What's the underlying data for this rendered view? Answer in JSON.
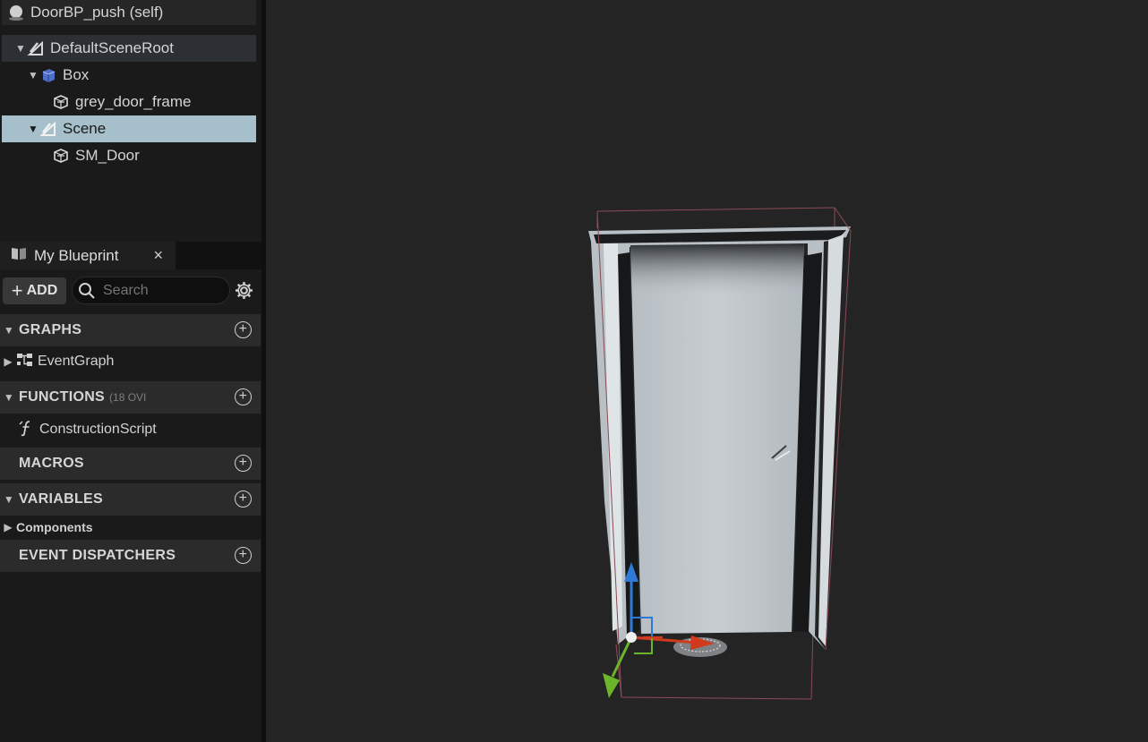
{
  "components": {
    "self_label": "DoorBP_push (self)",
    "items": [
      {
        "label": "DefaultSceneRoot",
        "icon": "scene-component-icon"
      },
      {
        "label": "Box",
        "icon": "box-collision-icon"
      },
      {
        "label": "grey_door_frame",
        "icon": "static-mesh-icon"
      },
      {
        "label": "Scene",
        "icon": "scene-component-icon",
        "selected": true
      },
      {
        "label": "SM_Door",
        "icon": "static-mesh-icon"
      }
    ]
  },
  "my_blueprint": {
    "tab_label": "My Blueprint",
    "close_glyph": "×",
    "add_label": "ADD",
    "search_placeholder": "Search",
    "sections": {
      "graphs": "GRAPHS",
      "functions": "FUNCTIONS",
      "functions_sub": "(18 OVI",
      "macros": "MACROS",
      "variables": "VARIABLES",
      "event_dispatchers": "EVENT DISPATCHERS"
    },
    "items": {
      "event_graph": "EventGraph",
      "construction_script": "ConstructionScript",
      "components_category": "Components"
    }
  },
  "colors": {
    "selected_row": "#a6c0cb",
    "viewport_bg": "#242424",
    "gizmo_x": "#d23a1f",
    "gizmo_y": "#6cb52b",
    "gizmo_z": "#2f7ad6"
  }
}
